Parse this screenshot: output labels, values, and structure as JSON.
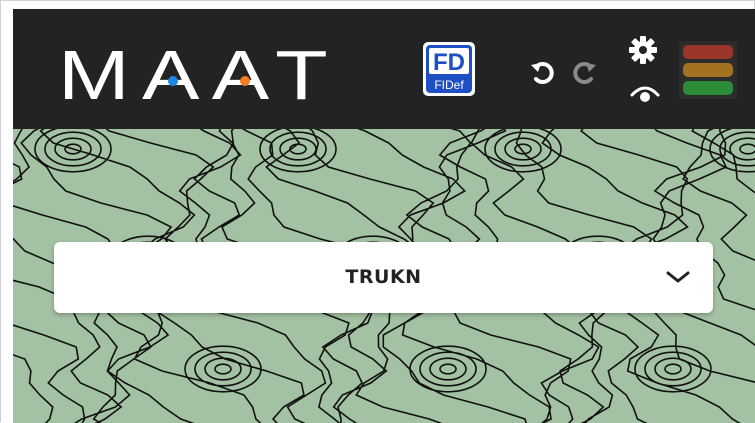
{
  "app": {
    "logo_text": "MAAT",
    "badge_top": "FD",
    "badge_bottom": "FIDef"
  },
  "toolbar": {
    "undo_icon": "undo-icon",
    "redo_icon": "redo-icon",
    "settings_icon": "gear-icon",
    "view_icon": "eye-icon",
    "status_icon": "traffic-light-icon"
  },
  "selector": {
    "selected_value": "TRUKN"
  },
  "colors": {
    "topbar": "#232323",
    "panel_bg": "#a3c1a3",
    "logo_dot_blue": "#1e88e5",
    "logo_dot_orange": "#f57c20",
    "badge_blue": "#1f4fc4",
    "light_red": "#c0392b",
    "light_amber": "#c98a1f",
    "light_green": "#2e9e3a"
  }
}
